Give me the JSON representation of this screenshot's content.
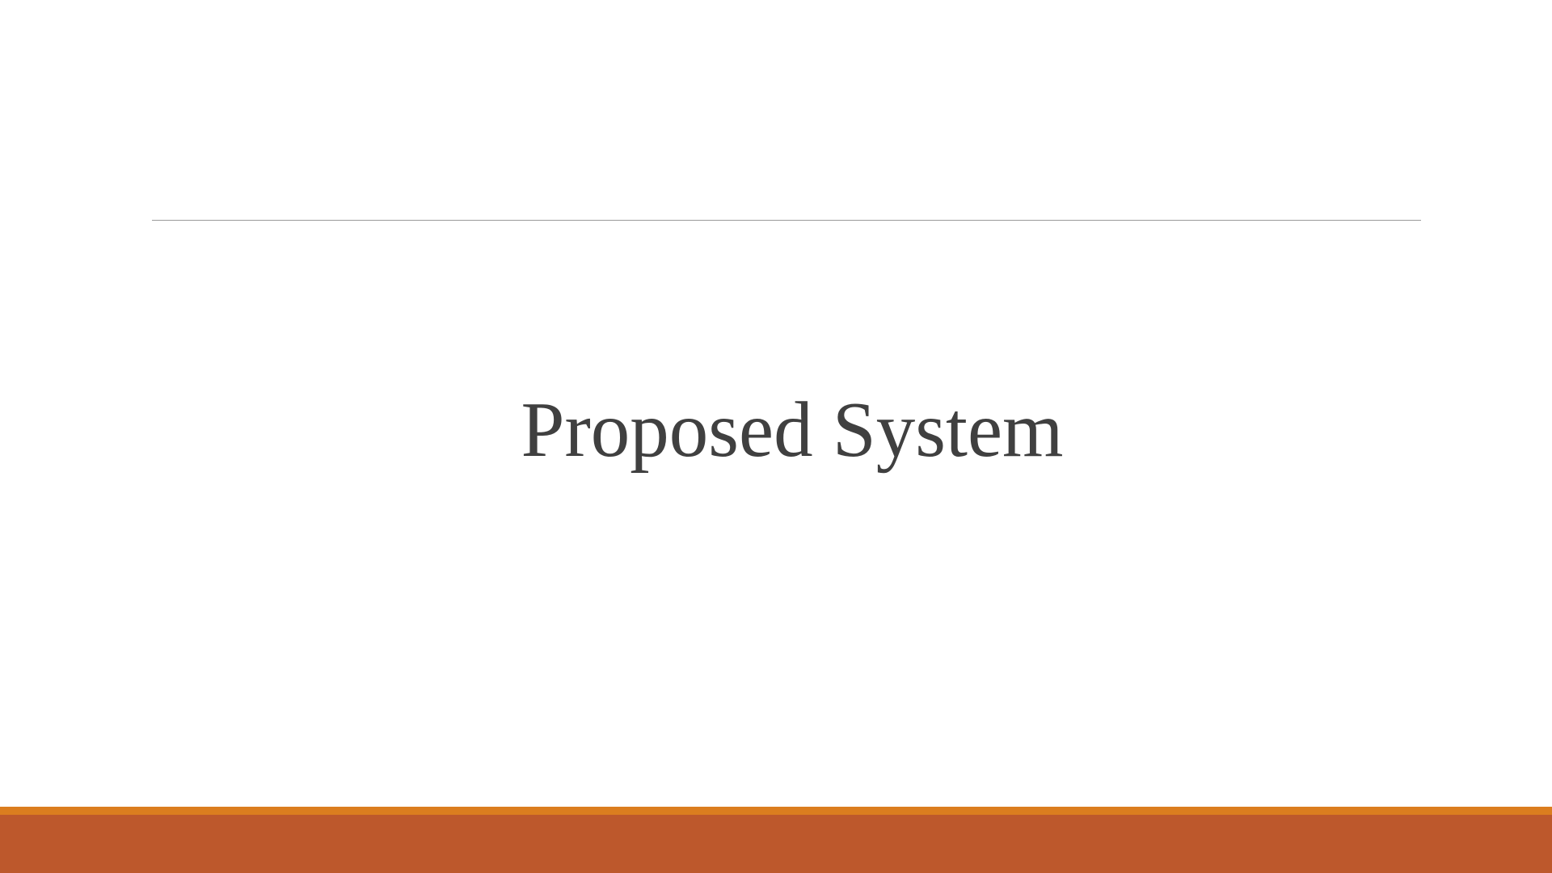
{
  "slide": {
    "title": "Proposed System"
  },
  "colors": {
    "title_text": "#404040",
    "divider": "#9a9a9a",
    "footer_accent": "#db7d1f",
    "footer_band": "#bd582c",
    "background": "#ffffff"
  }
}
